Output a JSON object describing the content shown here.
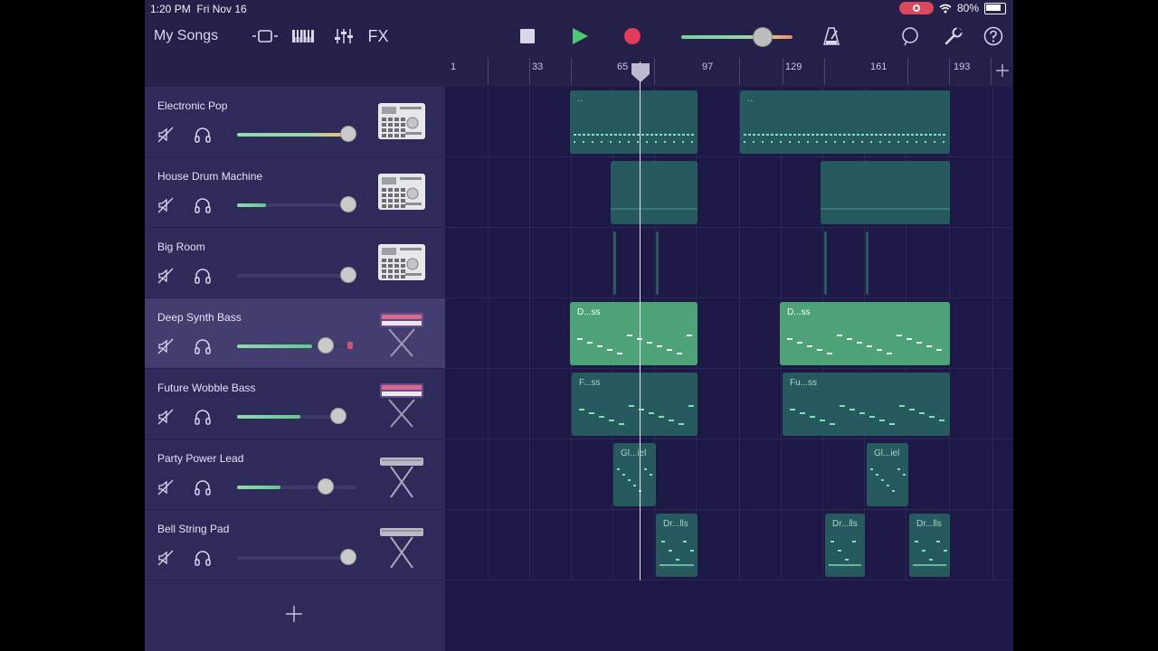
{
  "status_bar": {
    "time": "1:20 PM",
    "date": "Fri Nov 16",
    "battery": "80%"
  },
  "toolbar": {
    "my_songs": "My Songs",
    "fx": "FX",
    "icons": [
      "tracks-view-icon",
      "keyboard-icon",
      "mixer-icon",
      "stop-icon",
      "play-icon",
      "record-icon",
      "metronome-icon",
      "loop-icon",
      "settings-wrench-icon",
      "help-icon"
    ]
  },
  "master_volume": 0.72,
  "timeline": {
    "markers": [
      "1",
      "33",
      "65",
      "97",
      "129",
      "161",
      "193"
    ]
  },
  "tracks": [
    {
      "name": "Electronic Pop",
      "volume": 1.0,
      "instrument": "drum-machine"
    },
    {
      "name": "House Drum Machine",
      "volume": 0.24,
      "instrument": "drum-machine"
    },
    {
      "name": "Big Room",
      "volume": 0.0,
      "instrument": "drum-machine"
    },
    {
      "name": "Deep Synth Bass",
      "volume": 0.63,
      "instrument": "synth-on-stand",
      "selected": true
    },
    {
      "name": "Future Wobble Bass",
      "volume": 0.58,
      "instrument": "synth-on-stand"
    },
    {
      "name": "Party Power Lead",
      "volume": 0.36,
      "instrument": "keyboard-stand"
    },
    {
      "name": "Bell String Pad",
      "volume": 0.0,
      "instrument": "keyboard-stand"
    }
  ],
  "regions": {
    "electronic_pop": [
      "··",
      "··"
    ],
    "deep_synth_bass": [
      "D...ss",
      "D...ss"
    ],
    "future_wobble_bass": [
      "F...ss",
      "Fu...ss"
    ],
    "party_power_lead": [
      "Gl...iel",
      "Gl...iel"
    ],
    "bell_string_pad": [
      "Dr...lls",
      "Dr...lls",
      "Dr...lls"
    ]
  }
}
